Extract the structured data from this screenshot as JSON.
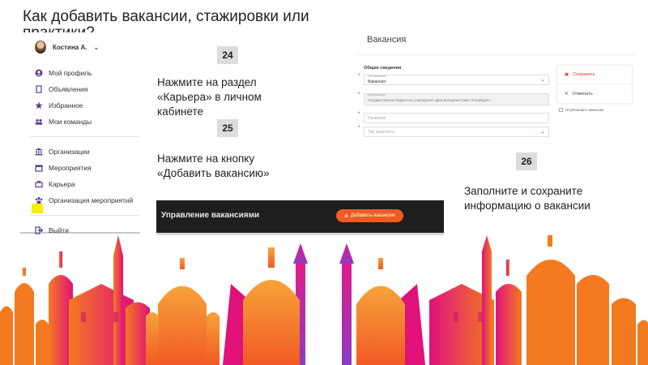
{
  "slide": {
    "title_line1": "Как добавить вакансии, стажировки или",
    "title_line2": "практики?"
  },
  "sidebar": {
    "user_name": "Костина А.",
    "items": [
      {
        "label": "Мой профиль",
        "icon": "profile-icon"
      },
      {
        "label": "Объявления",
        "icon": "document-icon"
      },
      {
        "label": "Избранное",
        "icon": "star-icon"
      },
      {
        "label": "Мои команды",
        "icon": "team-icon"
      },
      {
        "label": "Организации",
        "icon": "building-icon"
      },
      {
        "label": "Мероприятия",
        "icon": "calendar-icon"
      },
      {
        "label": "Карьера",
        "icon": "briefcase-icon"
      },
      {
        "label": "Организация мероприятий",
        "icon": "people-icon"
      },
      {
        "label": "Выйти",
        "icon": "logout-icon"
      }
    ],
    "highlight_color": "#f5f000"
  },
  "steps": [
    {
      "number": "24",
      "text": "Нажмите на раздел «Карьера» в личном кабинете"
    },
    {
      "number": "25",
      "text": "Нажмите на кнопку «Добавить вакансию»"
    },
    {
      "number": "26",
      "text": "Заполните и сохраните информацию о вакансии"
    }
  ],
  "manage_bar": {
    "title": "Управление вакансиями",
    "button_label": "Добавить вакансию",
    "button_color": "#f05a23"
  },
  "vacancy_form": {
    "header": "Вакансия",
    "section": "Общие сведения",
    "fields": [
      {
        "label": "Тип вакансии",
        "value": "Вакансия",
        "has_dropdown": true,
        "filled": false
      },
      {
        "label": "Организация",
        "value": "Государственное бюджетное учреждение «Дом молодежи Санкт-Петербурга»",
        "has_dropdown": false,
        "filled": true
      },
      {
        "label": "",
        "value": "Название",
        "has_dropdown": false,
        "filled": false
      },
      {
        "label": "",
        "value": "Тип занятости",
        "has_dropdown": true,
        "filled": false
      }
    ],
    "actions": {
      "save": "Сохранить",
      "cancel": "Отменить",
      "publish": "Опубликовать вакансию"
    }
  },
  "colors": {
    "accent": "#f05a23",
    "skyline_orange": "#f47a20",
    "skyline_magenta": "#e0127a",
    "skyline_purple": "#9b3ac0"
  }
}
